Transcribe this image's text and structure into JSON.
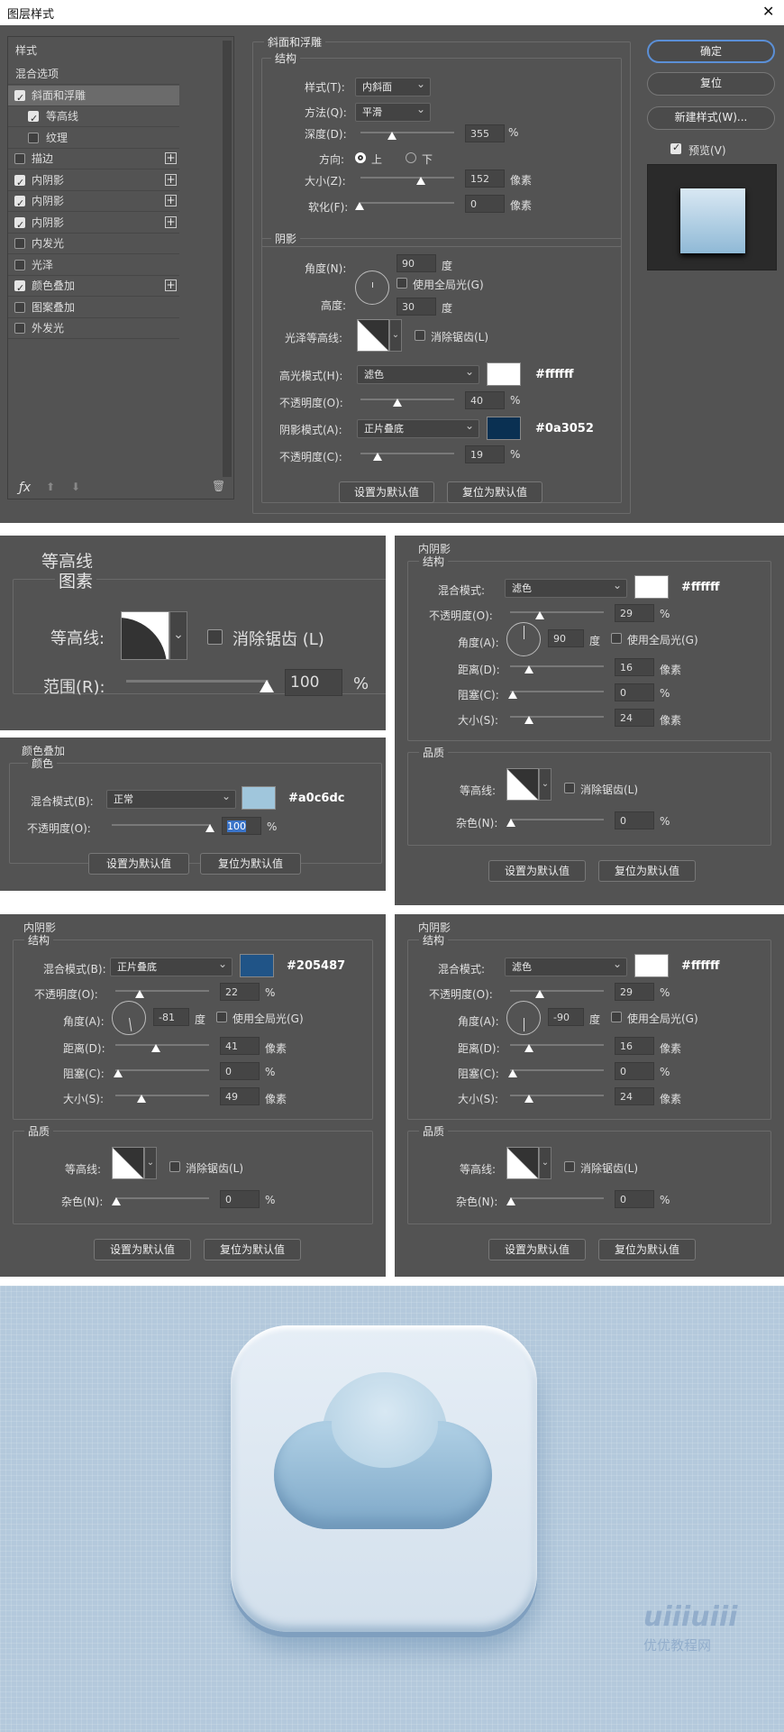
{
  "window": {
    "title": "图层样式",
    "close": "✕"
  },
  "sidebar": {
    "header": "样式",
    "items": [
      {
        "label": "混合选项",
        "check": null,
        "on": false,
        "plus": false,
        "active": false
      },
      {
        "label": "斜面和浮雕",
        "check": true,
        "on": true,
        "plus": false,
        "active": true
      },
      {
        "label": "等高线",
        "check": true,
        "on": true,
        "plus": false,
        "sub": true
      },
      {
        "label": "纹理",
        "check": true,
        "on": false,
        "plus": false,
        "sub": true
      },
      {
        "label": "描边",
        "check": true,
        "on": false,
        "plus": true
      },
      {
        "label": "内阴影",
        "check": true,
        "on": true,
        "plus": true
      },
      {
        "label": "内阴影",
        "check": true,
        "on": true,
        "plus": true
      },
      {
        "label": "内阴影",
        "check": true,
        "on": true,
        "plus": true
      },
      {
        "label": "内发光",
        "check": true,
        "on": false,
        "plus": false
      },
      {
        "label": "光泽",
        "check": true,
        "on": false,
        "plus": false
      },
      {
        "label": "颜色叠加",
        "check": true,
        "on": true,
        "plus": true
      },
      {
        "label": "图案叠加",
        "check": true,
        "on": false,
        "plus": false
      },
      {
        "label": "外发光",
        "check": true,
        "on": false,
        "plus": false
      }
    ]
  },
  "bevel": {
    "title": "斜面和浮雕",
    "structure": "结构",
    "style_label": "样式(T):",
    "style_value": "内斜面",
    "technique_label": "方法(Q):",
    "technique_value": "平滑",
    "depth_label": "深度(D):",
    "depth_value": "355",
    "depth_unit": "%",
    "direction_label": "方向:",
    "dir_up": "上",
    "dir_down": "下",
    "size_label": "大小(Z):",
    "size_value": "152",
    "size_unit": "像素",
    "soften_label": "软化(F):",
    "soften_value": "0",
    "soften_unit": "像素",
    "shading": "阴影",
    "angle_label": "角度(N):",
    "angle_value": "90",
    "angle_unit": "度",
    "global_light": "使用全局光(G)",
    "altitude_label": "高度:",
    "altitude_value": "30",
    "altitude_unit": "度",
    "gloss_label": "光泽等高线:",
    "antialias": "消除锯齿(L)",
    "hl_mode_label": "高光模式(H):",
    "hl_mode_value": "滤色",
    "hl_color": "#ffffff",
    "hl_hex": "#ffffff",
    "hl_opacity_label": "不透明度(O):",
    "hl_opacity_value": "40",
    "pct": "%",
    "sh_mode_label": "阴影模式(A):",
    "sh_mode_value": "正片叠底",
    "sh_color": "#0a3052",
    "sh_hex": "#0a3052",
    "sh_opacity_label": "不透明度(C):",
    "sh_opacity_value": "19",
    "set_default": "设置为默认值",
    "reset_default": "复位为默认值"
  },
  "right": {
    "ok": "确定",
    "reset": "复位",
    "new_style": "新建样式(W)...",
    "preview": "预览(V)"
  },
  "contour_panel": {
    "title": "等高线",
    "sub": "图素",
    "contour_label": "等高线:",
    "antialias": "消除锯齿 (L)",
    "range_label": "范围(R):",
    "range_value": "100",
    "pct": "%"
  },
  "overlay": {
    "title": "颜色叠加",
    "sub": "颜色",
    "mode_label": "混合模式(B):",
    "mode_value": "正常",
    "color": "#a0c6dc",
    "hex": "#a0c6dc",
    "opacity_label": "不透明度(O):",
    "opacity_value": "100",
    "pct": "%",
    "set_default": "设置为默认值",
    "reset_default": "复位为默认值"
  },
  "inner1": {
    "title": "内阴影",
    "structure": "结构",
    "mode_label": "混合模式:",
    "mode_value": "滤色",
    "color": "#ffffff",
    "hex": "#ffffff",
    "opacity_label": "不透明度(O):",
    "opacity_value": "29",
    "angle_label": "角度(A):",
    "angle_value": "90",
    "deg": "度",
    "global_light": "使用全局光(G)",
    "distance_label": "距离(D):",
    "distance_value": "16",
    "choke_label": "阻塞(C):",
    "choke_value": "0",
    "size_label": "大小(S):",
    "size_value": "24",
    "px": "像素",
    "pct": "%",
    "quality": "品质",
    "contour_label": "等高线:",
    "antialias": "消除锯齿(L)",
    "noise_label": "杂色(N):",
    "noise_value": "0",
    "set_default": "设置为默认值",
    "reset_default": "复位为默认值"
  },
  "inner2": {
    "title": "内阴影",
    "structure": "结构",
    "mode_label": "混合模式(B):",
    "mode_value": "正片叠底",
    "color": "#205487",
    "hex": "#205487",
    "opacity_label": "不透明度(O):",
    "opacity_value": "22",
    "angle_label": "角度(A):",
    "angle_value": "-81",
    "deg": "度",
    "global_light": "使用全局光(G)",
    "distance_label": "距离(D):",
    "distance_value": "41",
    "choke_label": "阻塞(C):",
    "choke_value": "0",
    "size_label": "大小(S):",
    "size_value": "49",
    "px": "像素",
    "pct": "%",
    "quality": "品质",
    "contour_label": "等高线:",
    "antialias": "消除锯齿(L)",
    "noise_label": "杂色(N):",
    "noise_value": "0",
    "set_default": "设置为默认值",
    "reset_default": "复位为默认值"
  },
  "inner3": {
    "title": "内阴影",
    "structure": "结构",
    "mode_label": "混合模式:",
    "mode_value": "滤色",
    "color": "#ffffff",
    "hex": "#ffffff",
    "opacity_label": "不透明度(O):",
    "opacity_value": "29",
    "angle_label": "角度(A):",
    "angle_value": "-90",
    "deg": "度",
    "global_light": "使用全局光(G)",
    "distance_label": "距离(D):",
    "distance_value": "16",
    "choke_label": "阻塞(C):",
    "choke_value": "0",
    "size_label": "大小(S):",
    "size_value": "24",
    "px": "像素",
    "pct": "%",
    "quality": "品质",
    "contour_label": "等高线:",
    "antialias": "消除锯齿(L)",
    "noise_label": "杂色(N):",
    "noise_value": "0",
    "set_default": "设置为默认值",
    "reset_default": "复位为默认值"
  },
  "result": {
    "watermark": "uiiiuiii",
    "watermark_sub": "优优教程网"
  }
}
